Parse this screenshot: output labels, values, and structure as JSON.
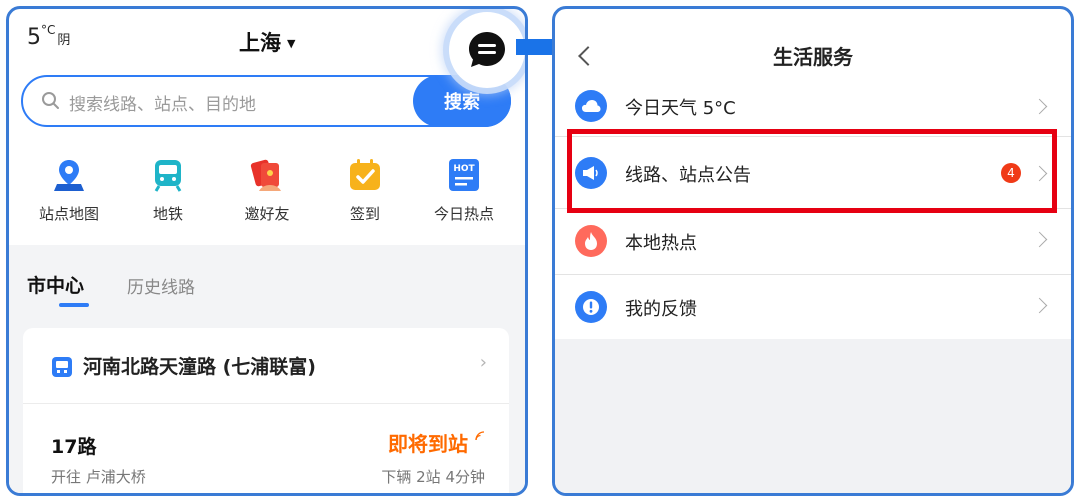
{
  "left": {
    "weather": {
      "temp": "5",
      "unit": "°C",
      "condition": "阴"
    },
    "city": {
      "name": "上海",
      "caret": "▼"
    },
    "search": {
      "placeholder": "搜索线路、站点、目的地",
      "button": "搜索"
    },
    "quick_links": [
      {
        "label": "站点地图",
        "icon": "map-pin-icon"
      },
      {
        "label": "地铁",
        "icon": "subway-icon"
      },
      {
        "label": "邀好友",
        "icon": "red-envelope-icon"
      },
      {
        "label": "签到",
        "icon": "calendar-check-icon"
      },
      {
        "label": "今日热点",
        "icon": "hot-news-icon",
        "badge": "HOT"
      }
    ],
    "tabs": {
      "active": "市中心",
      "inactive": "历史线路"
    },
    "card": {
      "stop_name": "河南北路天潼路 (七浦联富)",
      "route": "17路",
      "status": "即将到站",
      "destination": "开往 卢浦大桥",
      "eta": "下辆 2站 4分钟"
    }
  },
  "right": {
    "title": "生活服务",
    "items": [
      {
        "label": "今日天气 5°C",
        "icon": "cloud-icon",
        "color": "#2e7cf6"
      },
      {
        "label": "线路、站点公告",
        "icon": "megaphone-icon",
        "color": "#2e7cf6",
        "badge": "4"
      },
      {
        "label": "本地热点",
        "icon": "flame-icon",
        "color": "#ff6a5c"
      },
      {
        "label": "我的反馈",
        "icon": "exclamation-icon",
        "color": "#2e7cf6"
      }
    ]
  },
  "colors": {
    "accent": "#2e7cf6",
    "highlight": "#e60012",
    "arriving": "#ff6a00"
  }
}
